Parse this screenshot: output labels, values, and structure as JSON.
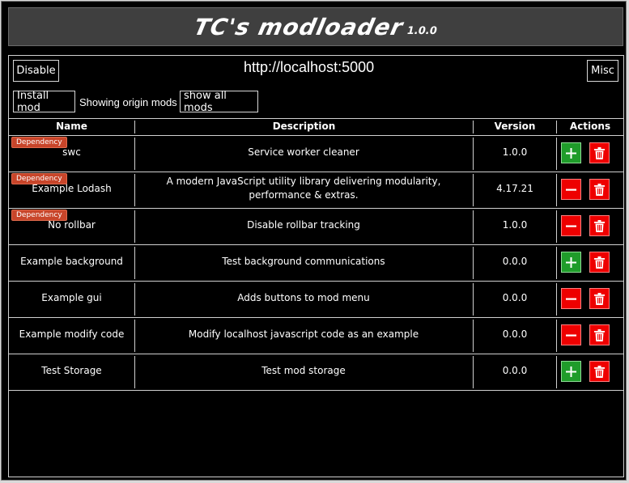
{
  "header": {
    "title": "TC's modloader",
    "version": "1.0.0"
  },
  "toolbar": {
    "disable_label": "Disable",
    "url": "http://localhost:5000",
    "misc_label": "Misc",
    "install_label": "Install mod",
    "showing_text": "Showing origin mods",
    "show_all_label": "show all mods"
  },
  "table": {
    "columns": [
      "Name",
      "Description",
      "Version",
      "Actions"
    ],
    "badge_label": "Dependency",
    "rows": [
      {
        "name": "swc",
        "description": "Service worker cleaner",
        "version": "1.0.0",
        "dependency": true,
        "state": "add"
      },
      {
        "name": "Example Lodash",
        "description": "A modern JavaScript utility library delivering modularity, performance & extras.",
        "version": "4.17.21",
        "dependency": true,
        "state": "remove"
      },
      {
        "name": "No rollbar",
        "description": "Disable rollbar tracking",
        "version": "1.0.0",
        "dependency": true,
        "state": "remove"
      },
      {
        "name": "Example background",
        "description": "Test background communications",
        "version": "0.0.0",
        "dependency": false,
        "state": "add"
      },
      {
        "name": "Example gui",
        "description": "Adds buttons to mod menu",
        "version": "0.0.0",
        "dependency": false,
        "state": "remove"
      },
      {
        "name": "Example modify code",
        "description": "Modify localhost javascript code as an example",
        "version": "0.0.0",
        "dependency": false,
        "state": "remove"
      },
      {
        "name": "Test Storage",
        "description": "Test mod storage",
        "version": "0.0.0",
        "dependency": false,
        "state": "add"
      }
    ]
  },
  "colors": {
    "add": "#1f9c2a",
    "remove": "#ee0000",
    "badge": "#c8452a"
  }
}
